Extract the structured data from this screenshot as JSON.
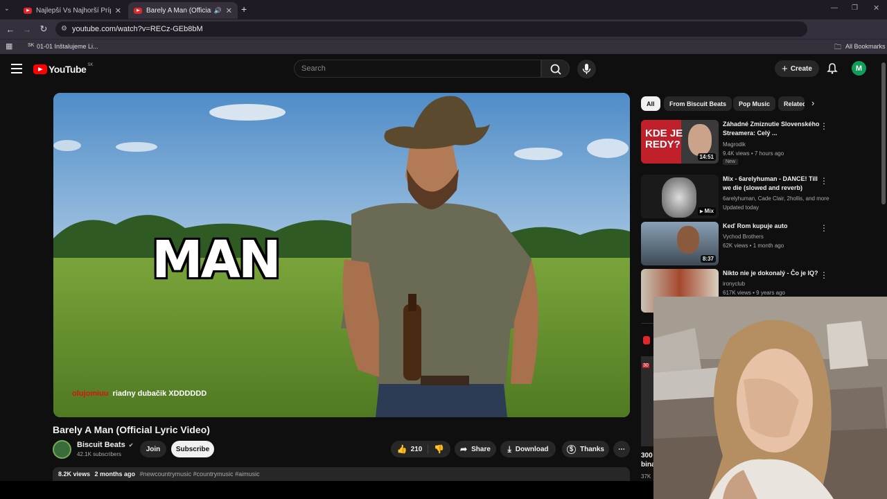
{
  "browser": {
    "tabs": [
      {
        "title": "Najlepší Vs Najhorší Prípady z",
        "active": false
      },
      {
        "title": "Barely A Man (Official Lyric",
        "active": true
      }
    ],
    "url": "youtube.com/watch?v=RECz-GEb8bM",
    "bookmark": "01-01 Inštalujeme Li...",
    "bookmark_badge": "SK",
    "all_bookmarks": "All Bookmarks"
  },
  "youtube": {
    "logo_text": "YouTube",
    "country_code": "SK",
    "search_placeholder": "Search",
    "create_label": "Create",
    "avatar_letter": "M"
  },
  "video": {
    "overlay_word": "MAN",
    "chat_user": "olujomiuu",
    "chat_message": "riadny dubačik XDDDDDD",
    "title": "Barely A Man (Official Lyric Video)",
    "channel": "Biscuit Beats",
    "subscribers": "42.1K subscribers",
    "join_label": "Join",
    "subscribe_label": "Subscribe",
    "likes": "210",
    "share_label": "Share",
    "download_label": "Download",
    "thanks_label": "Thanks",
    "views": "8.2K views",
    "age": "2 months ago",
    "tags": "#newcountrymusic #countrymusic #aimusic"
  },
  "chips": [
    "All",
    "From Biscuit Beats",
    "Pop Music",
    "Related"
  ],
  "recommendations": [
    {
      "title": "Záhadné Zmiznutie Slovenského Streamera: Celý ...",
      "channel": "Magrodik",
      "meta": "9.4K views • 7 hours ago",
      "badge": "New",
      "duration": "14:51",
      "thumb_text": "KDE JE REDY?"
    },
    {
      "title": "Mix - 6arelyhuman - DANCE! Till we die (slowed and reverb)",
      "channel": "6arelyhuman, Cade Clair, 2hollis, and more",
      "meta": "Updated today",
      "duration": "Mix"
    },
    {
      "title": "Keď Rom kupuje auto",
      "channel": "Vychod Brothers",
      "meta": "62K views • 1 month ago",
      "duration": "8:37"
    },
    {
      "title": "Nikto nie je dokonalý - Čo je IQ?",
      "channel": "ironyclub",
      "meta": "617K views • 9 years ago",
      "duration": ""
    }
  ],
  "partial_rec": {
    "line1": "300",
    "line2": "bina",
    "line3": "37K",
    "thumb_badge": "30"
  },
  "colors": {
    "bg": "#0f0f0f",
    "accent": "#ff0000",
    "chip_bg": "#272727",
    "avatar": "#0f9d58"
  }
}
